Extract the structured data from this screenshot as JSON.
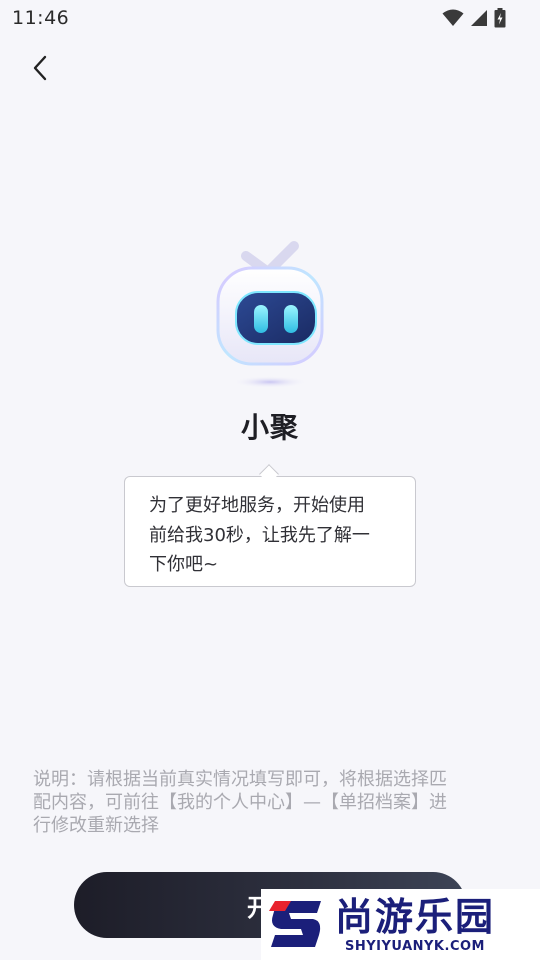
{
  "status_bar": {
    "time": "11:46",
    "icons": [
      "wifi-icon",
      "signal-icon",
      "battery-icon"
    ]
  },
  "nav": {
    "back_icon": "chevron-left-icon"
  },
  "assistant": {
    "name": "小聚",
    "message_lines": [
      "为了更好地服务，开始使用",
      "前给我30秒，让我先了解一",
      "下你吧~"
    ]
  },
  "note": {
    "lines": [
      "说明：请根据当前真实情况填写即可，将根据选择匹",
      "配内容，可前往【我的个人中心】—【单招档案】进",
      "行修改重新选择"
    ]
  },
  "start_button": {
    "label": "开"
  },
  "watermark": {
    "cn": "尚游乐园",
    "en": "SHYIYUANYK.COM"
  },
  "colors": {
    "background": "#f6f6fa",
    "button_dark": "#1d1d28",
    "note_gray": "#a9a9b0",
    "mascot_face": "#243a7a",
    "mascot_eyes": "#39d6f0",
    "watermark_blue": "#1b1f7a",
    "watermark_red": "#e8232e"
  }
}
